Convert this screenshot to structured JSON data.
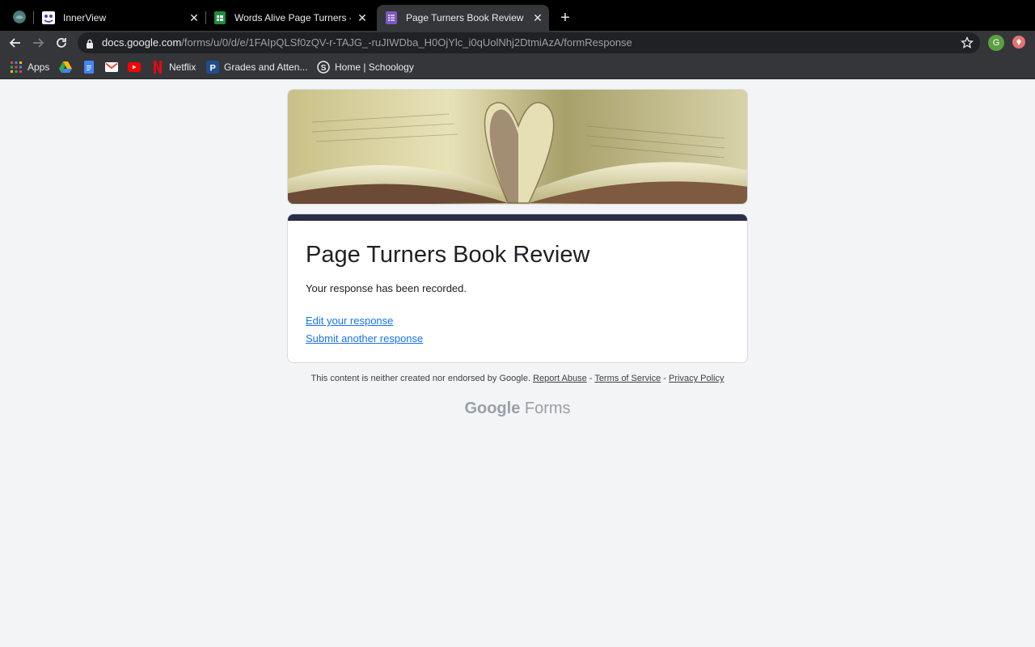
{
  "browser": {
    "tabs": [
      {
        "title": "InnerView",
        "active": false
      },
      {
        "title": "Words Alive Page Turners - Book",
        "active": false
      },
      {
        "title": "Page Turners Book Review",
        "active": true
      }
    ],
    "new_tab_glyph": "+",
    "close_glyph": "✕",
    "url_host": "docs.google.com",
    "url_path": "/forms/u/0/d/e/1FAIpQLSf0zQV-r-TAJG_-ruJIWDba_H0OjYlc_i0qUolNhj2DtmiAzA/formResponse",
    "profile_initial": "G",
    "bookmarks": {
      "apps": "Apps",
      "netflix": "Netflix",
      "grades": "Grades and Atten...",
      "schoology": "Home | Schoology"
    }
  },
  "form": {
    "title": "Page Turners Book Review",
    "confirmation": "Your response has been recorded.",
    "edit_link": "Edit your response",
    "another_link": "Submit another response"
  },
  "footer": {
    "disclaimer": "This content is neither created nor endorsed by Google.",
    "report_abuse": "Report Abuse",
    "sep1": " - ",
    "terms": "Terms of Service",
    "sep2": " - ",
    "privacy": "Privacy Policy",
    "brand_google": "Google",
    "brand_forms": "Forms"
  },
  "colors": {
    "accent": "#2a2e45",
    "link": "#1a73e8",
    "page_bg": "#f3f4f6"
  }
}
